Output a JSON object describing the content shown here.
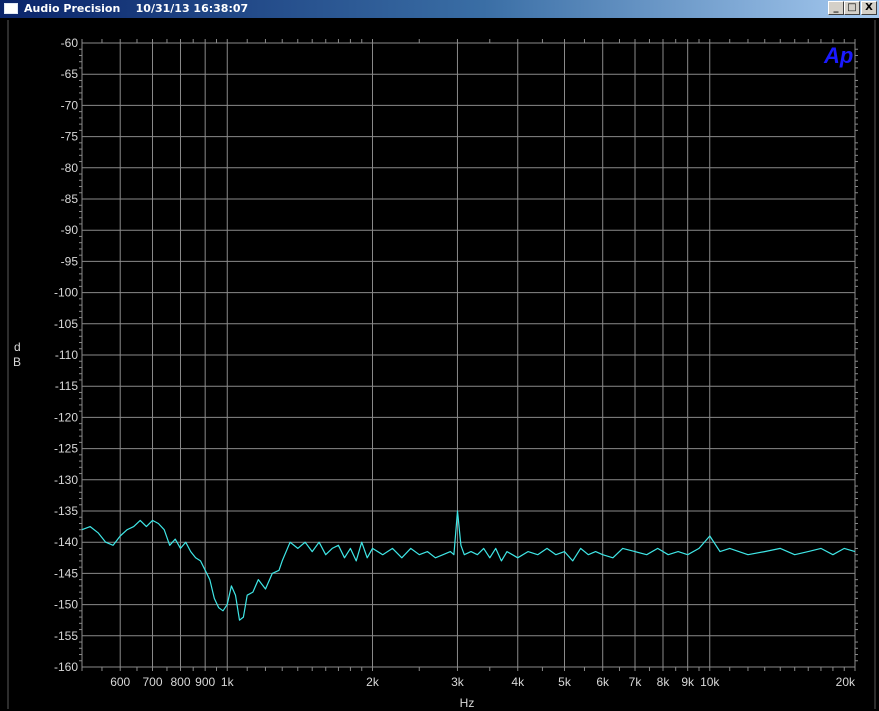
{
  "window": {
    "title": "Audio Precision    10/31/13 16:38:07",
    "buttons": {
      "minimize": "_",
      "maximize": "□",
      "close": "X"
    }
  },
  "logo_text": "Ap",
  "colors": {
    "trace": "#3fe6e6",
    "grid": "#8a8a8a",
    "background": "#000000",
    "logo": "#1a1aff"
  },
  "chart_data": {
    "type": "line",
    "title": "",
    "xlabel": "Hz",
    "ylabel": "dB",
    "xscale": "log",
    "xlim": [
      500,
      20000
    ],
    "ylim": [
      -160,
      -60
    ],
    "grid": true,
    "yticks": [
      -60,
      -65,
      -70,
      -75,
      -80,
      -85,
      -90,
      -95,
      -100,
      -105,
      -110,
      -115,
      -120,
      -125,
      -130,
      -135,
      -140,
      -145,
      -150,
      -155,
      -160
    ],
    "xticks": [
      {
        "value": 600,
        "label": "600"
      },
      {
        "value": 700,
        "label": "700"
      },
      {
        "value": 800,
        "label": "800"
      },
      {
        "value": 900,
        "label": "900"
      },
      {
        "value": 1000,
        "label": "1k"
      },
      {
        "value": 2000,
        "label": "2k"
      },
      {
        "value": 3000,
        "label": "3k"
      },
      {
        "value": 4000,
        "label": "4k"
      },
      {
        "value": 5000,
        "label": "5k"
      },
      {
        "value": 6000,
        "label": "6k"
      },
      {
        "value": 7000,
        "label": "7k"
      },
      {
        "value": 8000,
        "label": "8k"
      },
      {
        "value": 9000,
        "label": "9k"
      },
      {
        "value": 10000,
        "label": "10k"
      },
      {
        "value": 20000,
        "label": "20k"
      }
    ],
    "series": [
      {
        "x": [
          500,
          520,
          540,
          560,
          580,
          600,
          620,
          640,
          660,
          680,
          700,
          720,
          740,
          760,
          780,
          800,
          820,
          840,
          860,
          880,
          900,
          920,
          940,
          960,
          980,
          1000,
          1020,
          1040,
          1060,
          1080,
          1100,
          1130,
          1160,
          1200,
          1240,
          1280,
          1300,
          1350,
          1400,
          1450,
          1500,
          1550,
          1600,
          1650,
          1700,
          1750,
          1800,
          1850,
          1900,
          1950,
          2000,
          2100,
          2200,
          2300,
          2400,
          2500,
          2600,
          2700,
          2800,
          2900,
          2950,
          3000,
          3050,
          3100,
          3200,
          3300,
          3400,
          3500,
          3600,
          3700,
          3800,
          3900,
          4000,
          4200,
          4400,
          4600,
          4800,
          5000,
          5200,
          5400,
          5600,
          5800,
          6000,
          6300,
          6600,
          7000,
          7400,
          7800,
          8200,
          8600,
          9000,
          9500,
          10000,
          10500,
          11000,
          12000,
          13000,
          14000,
          15000,
          16000,
          17000,
          18000,
          19000,
          20000
        ],
        "y": [
          -138,
          -137.5,
          -138.5,
          -140,
          -140.5,
          -139,
          -138,
          -137.5,
          -136.5,
          -137.5,
          -136.5,
          -137,
          -138,
          -140.5,
          -139.5,
          -141,
          -140,
          -141.5,
          -142.5,
          -143,
          -144.5,
          -146,
          -149,
          -150.5,
          -151,
          -150,
          -147,
          -148.5,
          -152.5,
          -152,
          -148.5,
          -148,
          -146,
          -147.5,
          -145,
          -144.5,
          -143,
          -140,
          -141,
          -140,
          -141.5,
          -140,
          -142,
          -141,
          -140.5,
          -142.5,
          -141,
          -143,
          -140,
          -142.5,
          -141,
          -142,
          -141,
          -142.5,
          -141,
          -142,
          -141.5,
          -142.5,
          -142,
          -141.5,
          -142,
          -135,
          -140.5,
          -142,
          -141.5,
          -142,
          -141,
          -142.5,
          -141,
          -143,
          -141.5,
          -142,
          -142.5,
          -141.5,
          -142,
          -141,
          -142,
          -141.5,
          -143,
          -141,
          -142,
          -141.5,
          -142,
          -142.5,
          -141,
          -141.5,
          -142,
          -141,
          -142,
          -141.5,
          -142,
          -141,
          -139,
          -141.5,
          -141,
          -142,
          -141.5,
          -141,
          -142,
          -141.5,
          -141,
          -142,
          -141,
          -141.5
        ]
      }
    ]
  }
}
